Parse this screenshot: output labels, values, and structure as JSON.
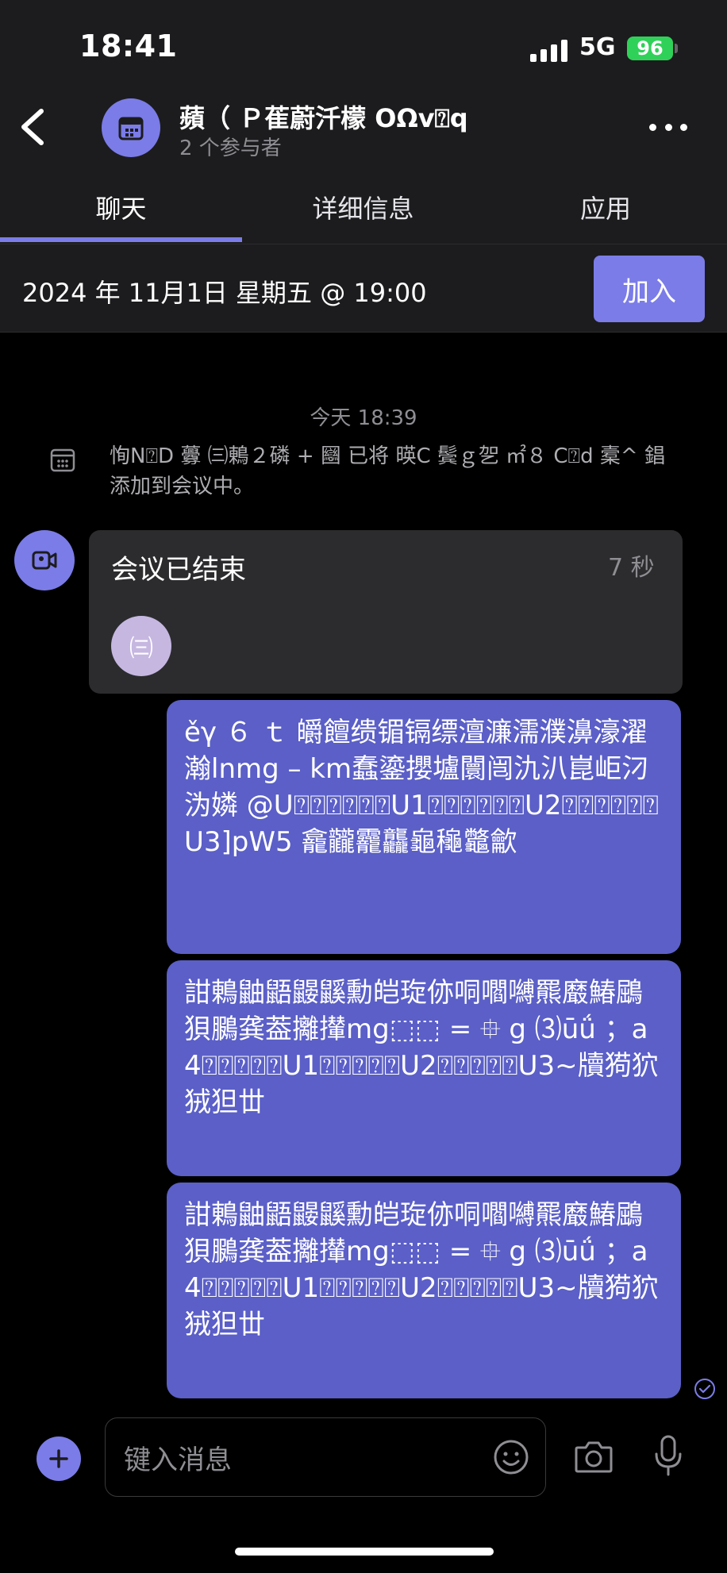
{
  "status": {
    "time": "18:41",
    "network": "5G",
    "battery": "96"
  },
  "header": {
    "title": "蘋（ Ｐ萑蔚汘檬 OΩv⍰q",
    "subtitle": "2 个参与者"
  },
  "tabs": [
    {
      "label": "聊天",
      "active": true
    },
    {
      "label": "详细信息",
      "active": false
    },
    {
      "label": "应用",
      "active": false
    }
  ],
  "meeting": {
    "date": "2024 年 11月1日 星期五 @ 19:00",
    "join_label": "加入"
  },
  "chat": {
    "day_label": "今天 18:39",
    "system_message": "恂N⍰D 虋 ㈢鶇２磷 + 圝 已将 暎C 鬓ｇ乫 ㎡８ C⍰d 槖^ 錩 添加到会议中。",
    "call": {
      "title": "会议已结束",
      "duration": "7 秒",
      "participant": "㈢"
    },
    "messages": [
      {
        "text": "ěγ ６ ｔ 皭饘缋镅镉缥澶濂濡濮濞濠濯瀚lnmg – km蠢鎏攖壚闤闿氿汃崑岠汈沩嫾 @U⍰⍰⍰⍰⍰⍰U1⍰⍰⍰⍰⍰⍰U2⍰⍰⍰⍰⍰⍰U3]pW5 龕龖龗龘龜龝龞龡"
      },
      {
        "text": "詌鶇鼬鼯鼹鼷勳皑琁㑊哃嚪嚩羆黀鰆鶌狽鵩龚葢攡攆mg⬚⬚ = ⯐ g ⑶ūǘ ；a4⍰⍰⍰⍰⍰U1⍰⍰⍰⍰⍰U2⍰⍰⍰⍰⍰U3~牘㺃狖狨狚丗"
      },
      {
        "text": "詌鶇鼬鼯鼹鼷勳皑琁㑊哃嚪嚩羆黀鰆鶌狽鵩龚葢攡攆mg⬚⬚ = ⯐ g ⑶ūǘ ；a4⍰⍰⍰⍰⍰U1⍰⍰⍰⍰⍰U2⍰⍰⍰⍰⍰U3~牘㺃狖狨狚丗"
      }
    ]
  },
  "composer": {
    "placeholder": "键入消息"
  },
  "colors": {
    "accent": "#7b7ce8",
    "bubble": "#5b5fc7",
    "background": "#000000",
    "panel": "#1c1c1e"
  }
}
